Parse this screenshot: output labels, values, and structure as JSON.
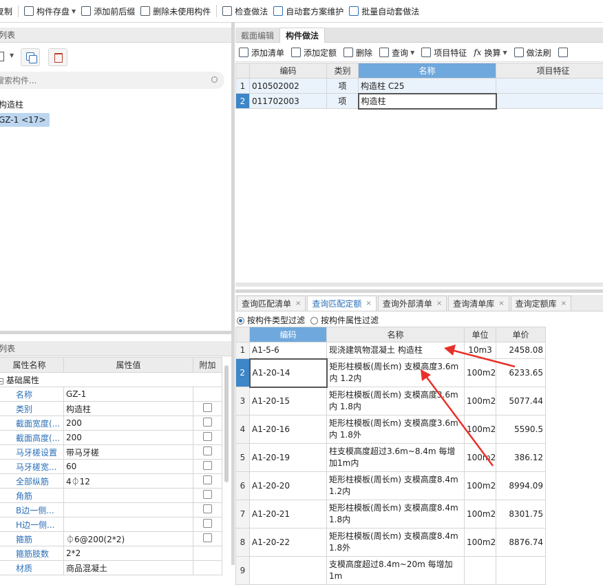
{
  "toolbar": {
    "items": [
      "复制",
      "构件存盘",
      "添加前后缀",
      "删除未使用构件",
      "检查做法",
      "自动套方案维护",
      "批量自动套做法"
    ]
  },
  "left_top": {
    "title": "列表",
    "search_placeholder": "搜索构件...",
    "tree_group": "构造柱",
    "tree_item": "GZ-1 <17>"
  },
  "left_bottom": {
    "title": "列表",
    "headers": [
      "属性名称",
      "属性值",
      "附加"
    ],
    "group": "基础属性",
    "rows": [
      {
        "name": "名称",
        "value": "GZ-1",
        "cb": false
      },
      {
        "name": "类别",
        "value": "构造柱",
        "cb": true
      },
      {
        "name": "截面宽度(...",
        "value": "200",
        "cb": true
      },
      {
        "name": "截面高度(...",
        "value": "200",
        "cb": true
      },
      {
        "name": "马牙槎设置",
        "value": "带马牙槎",
        "cb": true
      },
      {
        "name": "马牙槎宽...",
        "value": "60",
        "cb": true
      },
      {
        "name": "全部纵筋",
        "value": "4⏀12",
        "cb": true
      },
      {
        "name": "角筋",
        "value": "",
        "cb": true
      },
      {
        "name": "B边一侧...",
        "value": "",
        "cb": true
      },
      {
        "name": "H边一侧...",
        "value": "",
        "cb": true
      },
      {
        "name": "箍筋",
        "value": "⏀6@200(2*2)",
        "cb": true
      },
      {
        "name": "箍筋肢数",
        "value": "2*2",
        "cb": false
      },
      {
        "name": "材质",
        "value": "商品混凝土",
        "cb": false
      }
    ]
  },
  "right_tabs": [
    "截面编辑",
    "构件做法"
  ],
  "right_toolbar": [
    "添加清单",
    "添加定额",
    "删除",
    "查询",
    "项目特征",
    "换算",
    "做法刷"
  ],
  "method_table": {
    "headers": [
      "编码",
      "类别",
      "名称",
      "项目特征"
    ],
    "rows": [
      {
        "num": "1",
        "code": "010502002",
        "type": "项",
        "name": "构造柱 C25"
      },
      {
        "num": "2",
        "code": "011702003",
        "type": "项",
        "name": "构造柱"
      }
    ]
  },
  "bottom_tabs": [
    "查询匹配清单",
    "查询匹配定额",
    "查询外部清单",
    "查询清单库",
    "查询定额库"
  ],
  "filters": [
    "按构件类型过滤",
    "按构件属性过滤"
  ],
  "query_table": {
    "headers": [
      "编码",
      "名称",
      "单位",
      "单价"
    ],
    "rows": [
      {
        "num": "1",
        "code": "A1-5-6",
        "name": "现浇建筑物混凝土 构造柱",
        "unit": "10m3",
        "price": "2458.08"
      },
      {
        "num": "2",
        "code": "A1-20-14",
        "name": "矩形柱模板(周长m) 支模高度3.6m内 1.2内",
        "unit": "100m2",
        "price": "6233.65"
      },
      {
        "num": "3",
        "code": "A1-20-15",
        "name": "矩形柱模板(周长m) 支模高度3.6m内 1.8内",
        "unit": "100m2",
        "price": "5077.44"
      },
      {
        "num": "4",
        "code": "A1-20-16",
        "name": "矩形柱模板(周长m) 支模高度3.6m内 1.8外",
        "unit": "100m2",
        "price": "5590.5"
      },
      {
        "num": "5",
        "code": "A1-20-19",
        "name": "柱支模高度超过3.6m~8.4m 每增加1m内",
        "unit": "100m2",
        "price": "386.12"
      },
      {
        "num": "6",
        "code": "A1-20-20",
        "name": "矩形柱模板(周长m) 支模高度8.4m 1.2内",
        "unit": "100m2",
        "price": "8994.09"
      },
      {
        "num": "7",
        "code": "A1-20-21",
        "name": "矩形柱模板(周长m) 支模高度8.4m 1.8内",
        "unit": "100m2",
        "price": "8301.75"
      },
      {
        "num": "8",
        "code": "A1-20-22",
        "name": "矩形柱模板(周长m) 支模高度8.4m 1.8外",
        "unit": "100m2",
        "price": "8876.74"
      },
      {
        "num": "9",
        "code": "",
        "name": "支模高度超过8.4m~20m 每增加1m",
        "unit": "",
        "price": ""
      }
    ]
  },
  "colors": {
    "accent": "#2a6fb8",
    "header_selected": "#6fa8dc",
    "annotation": "#e8302a"
  }
}
